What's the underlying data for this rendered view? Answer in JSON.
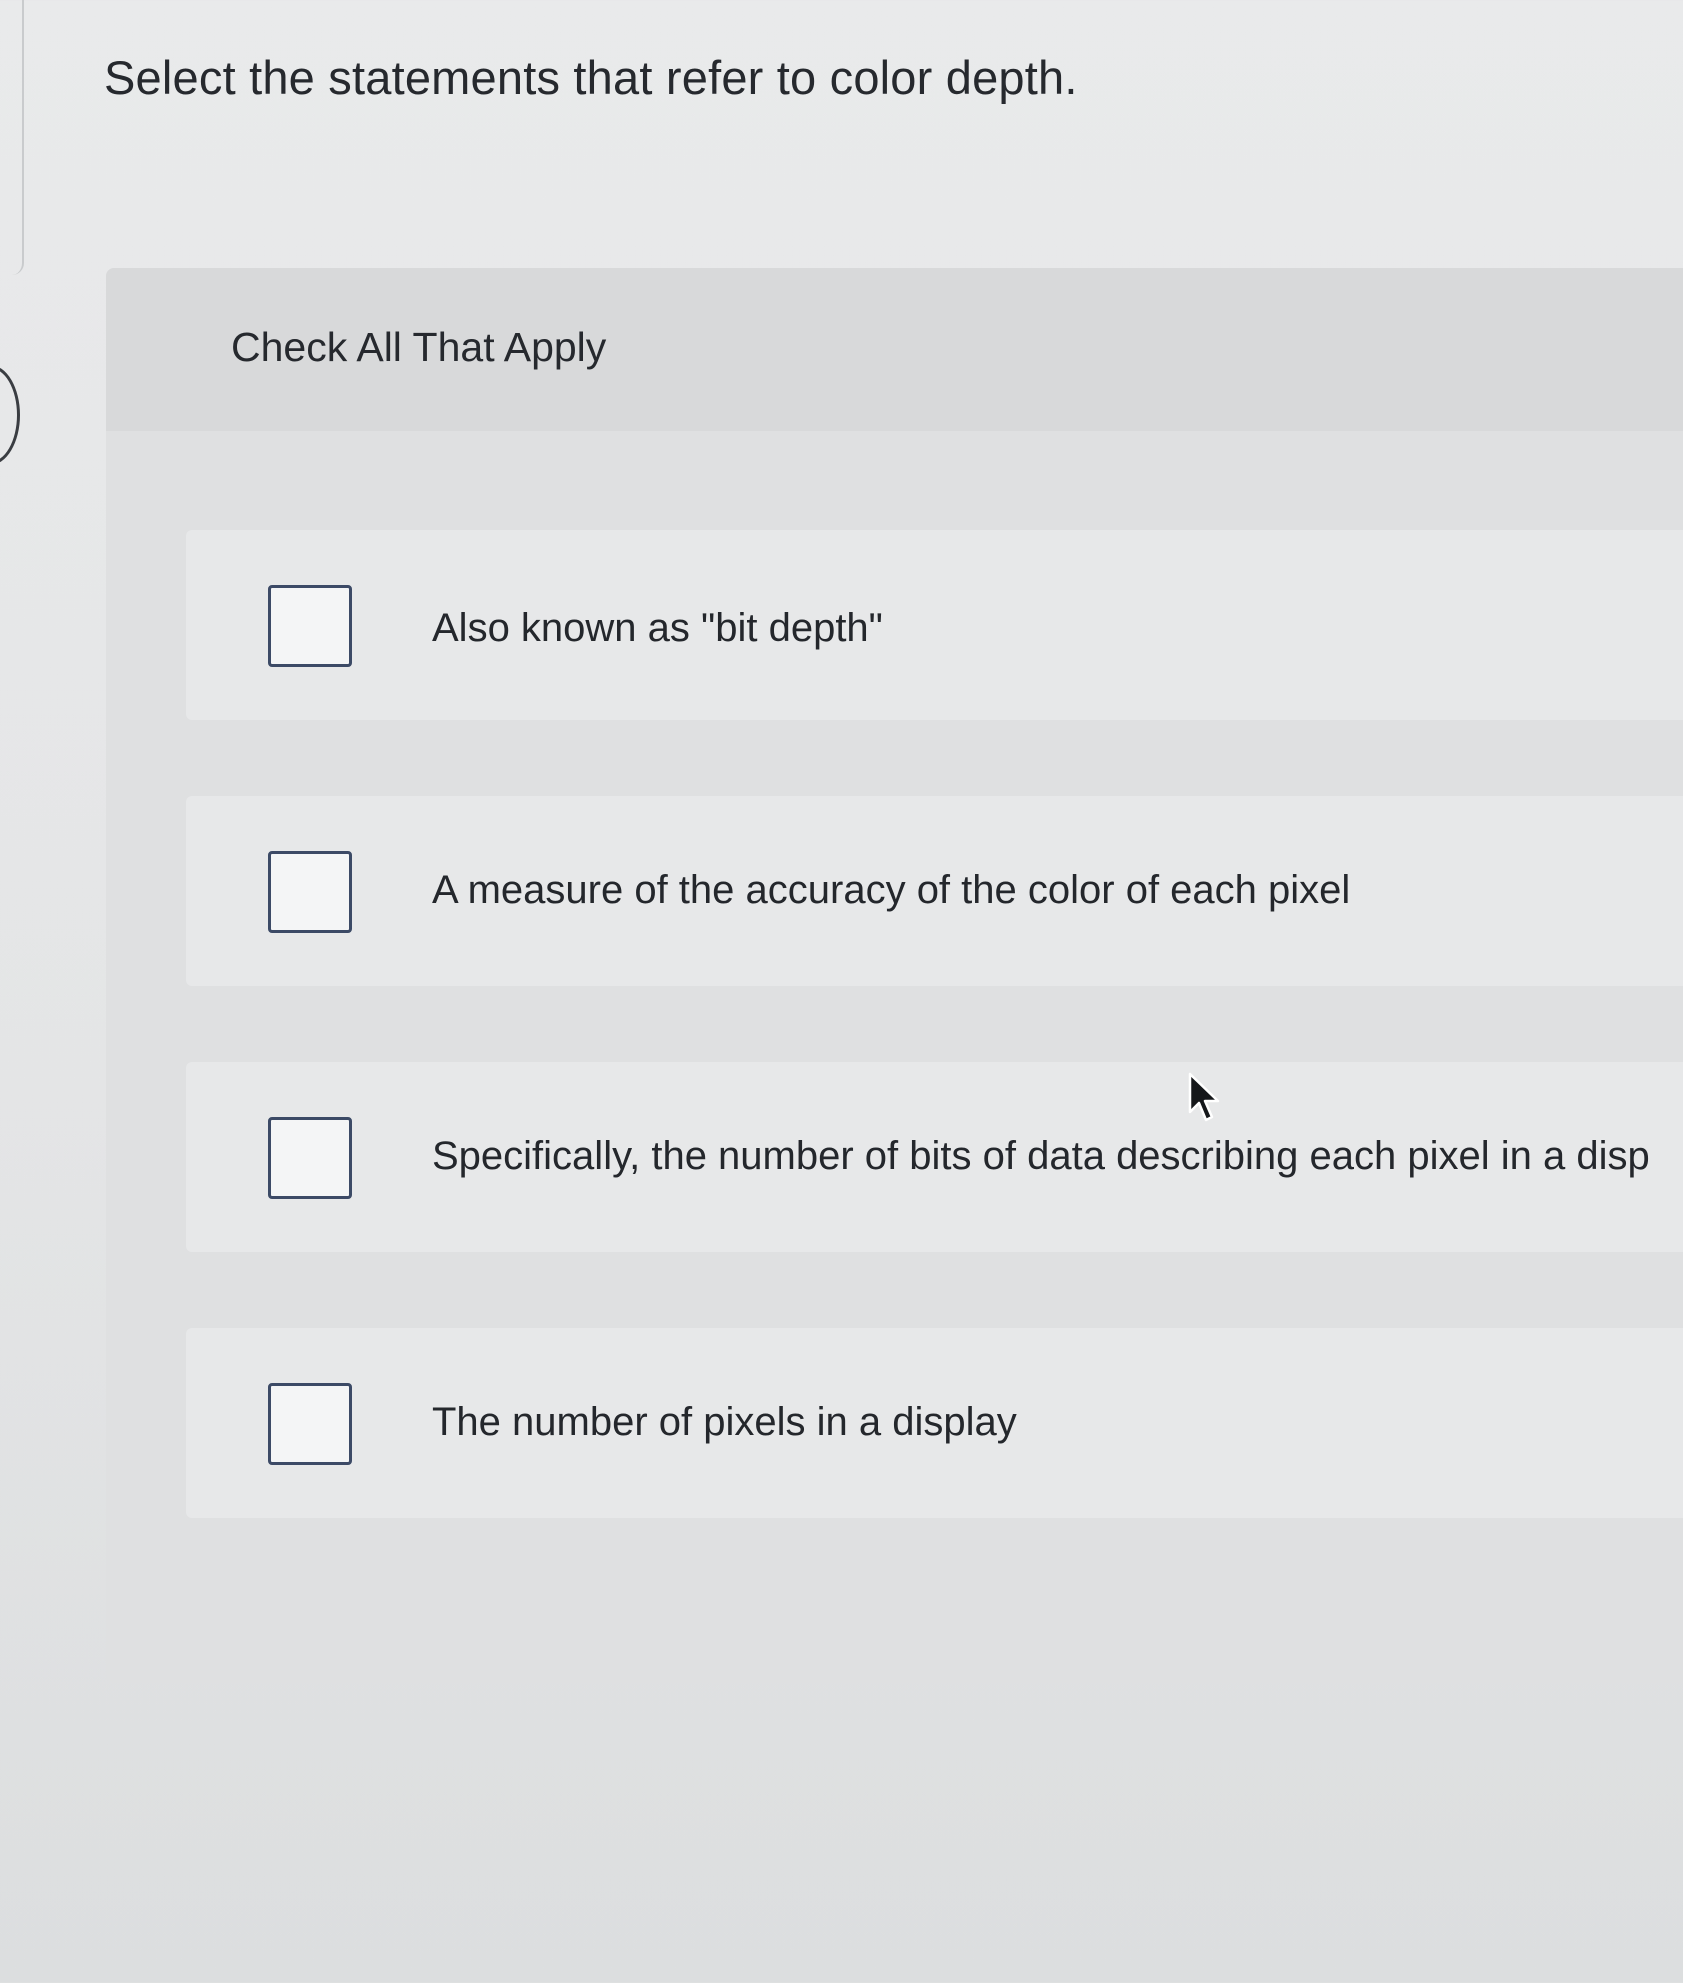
{
  "question": {
    "title": "Select the statements that refer to color depth."
  },
  "panel": {
    "subtitle": "Check All That Apply"
  },
  "options": [
    {
      "label": "Also known as \"bit depth\"",
      "checked": false
    },
    {
      "label": "A measure of the accuracy of the color of each pixel",
      "checked": false
    },
    {
      "label": "Specifically, the number of bits of data describing each pixel in a disp",
      "checked": false
    },
    {
      "label": "The number of pixels in a display",
      "checked": false
    }
  ],
  "icons": {
    "cursor": "mouse-pointer-icon"
  },
  "colors": {
    "checkbox_border": "#3c4a66",
    "text": "#24272c"
  }
}
